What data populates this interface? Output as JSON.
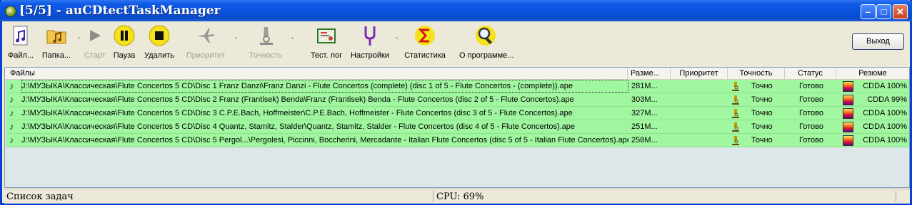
{
  "window": {
    "title": "[5/5] - auCDtectTaskManager"
  },
  "toolbar": {
    "files_label": "Файл...",
    "folder_label": "Папка...",
    "start_label": "Старт",
    "pause_label": "Пауза",
    "delete_label": "Удалить",
    "priority_label": "Приоритет",
    "accuracy_label": "Точность",
    "testlog_label": "Тест. лог",
    "settings_label": "Настройки",
    "stats_label": "Статистика",
    "about_label": "О программе...",
    "exit_label": "Выход"
  },
  "columns": {
    "files": "Файлы",
    "size": "Разме...",
    "priority": "Приоритет",
    "accuracy": "Точность",
    "status": "Статус",
    "summary": "Резюме"
  },
  "rows": [
    {
      "path": "J:\\МУЗЫКА\\Классическая\\Flute Concertos 5 CD\\Disc 1 Franz Danzi\\Franz Danzi - Flute Concertos (complete) (disc 1 of 5 - Flute Concertos - (complete)).ape",
      "size": "281M...",
      "priority": "",
      "accuracy": "Точно",
      "status": "Готово",
      "summary": "CDDA 100%"
    },
    {
      "path": "J:\\МУЗЫКА\\Классическая\\Flute Concertos 5 CD\\Disc 2 Franz (Frantisek) Benda\\Franz (Frantisek) Benda - Flute Concertos (disc 2 of 5 - Flute Concertos).ape",
      "size": "303M...",
      "priority": "",
      "accuracy": "Точно",
      "status": "Готово",
      "summary": "CDDA 99%"
    },
    {
      "path": "J:\\МУЗЫКА\\Классическая\\Flute Concertos 5 CD\\Disc 3 C.P.E.Bach, Hoffmeister\\C.P.E.Bach, Hoffmeister - Flute Concertos (disc 3 of 5 - Flute Concertos).ape",
      "size": "327M...",
      "priority": "",
      "accuracy": "Точно",
      "status": "Готово",
      "summary": "CDDA 100%"
    },
    {
      "path": "J:\\МУЗЫКА\\Классическая\\Flute Concertos 5 CD\\Disc 4 Quantz, Stamitz, Stalder\\Quantz, Stamitz, Stalder - Flute Concertos (disc 4 of 5 - Flute Concertos).ape",
      "size": "251M...",
      "priority": "",
      "accuracy": "Точно",
      "status": "Готово",
      "summary": "CDDA 100%"
    },
    {
      "path": "J:\\МУЗЫКА\\Классическая\\Flute Concertos 5 CD\\Disc 5 Pergol...\\Pergolesi, Piccinni, Boccherini, Mercadante - Italian Flute Concertos (disc 5 of 5 - Italian Flute Concertos).ape",
      "size": "258M...",
      "priority": "",
      "accuracy": "Точно",
      "status": "Готово",
      "summary": "CDDA 100%"
    }
  ],
  "statusbar": {
    "left": "Список задач",
    "cpu": "CPU: 69%"
  },
  "colors": {
    "title_bar": "#0a50d8",
    "row_done": "#a0f7a0",
    "list_bg": "#dde7ea",
    "window_bg": "#ece9d8"
  }
}
